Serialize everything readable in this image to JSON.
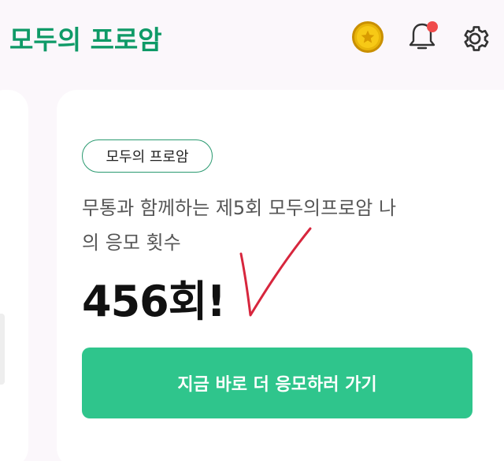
{
  "header": {
    "logo_text": "모두의 프로암",
    "icons": [
      "coin-star-icon",
      "bell-icon",
      "gear-icon"
    ]
  },
  "card": {
    "chip_label": "모두의 프로암",
    "description_line1": "무통과 함께하는 제5회 모두의프로암 나",
    "description_line2": "의 응모 횟수",
    "entry_count": "456회!",
    "cta_label": "지금 바로 더 응모하러 가기"
  },
  "colors": {
    "brand_green": "#0f9a67",
    "cta_green": "#2fc58c",
    "notification_red": "#f04b4b",
    "coin_gold": "#f7c916",
    "handwritten_check": "#d7263d"
  }
}
